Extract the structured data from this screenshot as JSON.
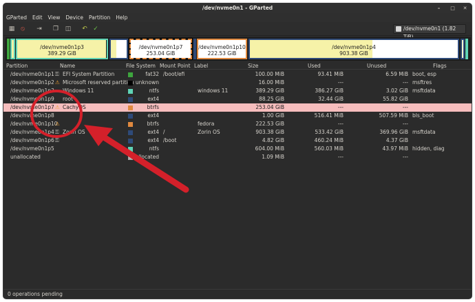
{
  "window": {
    "title": "/dev/nvme0n1 - GParted"
  },
  "menu": [
    "GParted",
    "Edit",
    "View",
    "Device",
    "Partition",
    "Help"
  ],
  "device_selector": "/dev/nvme0n1 (1.82 TiB)",
  "visual": [
    {
      "name": "/dev/nvme0n1p3",
      "size": "389.29 GiB"
    },
    {
      "name": "/dev/nvme0n1p7",
      "size": "253.04 GiB"
    },
    {
      "name": "/dev/nvme0n1p10",
      "size": "222.53 GiB"
    },
    {
      "name": "/dev/nvme0n1p4",
      "size": "903.38 GiB"
    }
  ],
  "columns": [
    "Partition",
    "Name",
    "File System",
    "Mount Point",
    "Label",
    "Size",
    "Used",
    "Unused",
    "Flags"
  ],
  "rows": [
    {
      "partition": "/dev/nvme0n1p1",
      "name": "EFI System Partition",
      "fs": "fat32",
      "mount": "/boot/efi",
      "label": "",
      "size": "100.00 MiB",
      "used": "93.41 MiB",
      "unused": "6.59 MiB",
      "flags": "boot, esp",
      "key": true,
      "warn": false,
      "color": "#3ea53e"
    },
    {
      "partition": "/dev/nvme0n1p2",
      "name": "Microsoft reserved partition",
      "fs": "unknown",
      "mount": "",
      "label": "",
      "size": "16.00 MiB",
      "used": "---",
      "unused": "---",
      "flags": "msftres",
      "key": false,
      "warn": true,
      "color": "#000000"
    },
    {
      "partition": "/dev/nvme0n1p3",
      "name": "Windows 11",
      "fs": "ntfs",
      "mount": "",
      "label": "windows 11",
      "size": "389.29 GiB",
      "used": "386.27 GiB",
      "unused": "3.02 GiB",
      "flags": "msftdata",
      "key": false,
      "warn": false,
      "color": "#5fd3b5"
    },
    {
      "partition": "/dev/nvme0n1p9",
      "name": "root",
      "fs": "ext4",
      "mount": "",
      "label": "",
      "size": "88.25 GiB",
      "used": "32.44 GiB",
      "unused": "55.82 GiB",
      "flags": "",
      "key": false,
      "warn": false,
      "color": "#2e4a79"
    },
    {
      "partition": "/dev/nvme0n1p7",
      "name": "CachyOS",
      "fs": "btrfs",
      "mount": "",
      "label": "",
      "size": "253.04 GiB",
      "used": "---",
      "unused": "---",
      "flags": "",
      "key": false,
      "warn": true,
      "color": "#e0893f",
      "selected": true
    },
    {
      "partition": "/dev/nvme0n1p8",
      "name": "",
      "fs": "ext4",
      "mount": "",
      "label": "",
      "size": "1.00 GiB",
      "used": "516.41 MiB",
      "unused": "507.59 MiB",
      "flags": "bls_boot",
      "key": false,
      "warn": false,
      "color": "#2e4a79"
    },
    {
      "partition": "/dev/nvme0n1p10",
      "name": "",
      "fs": "btrfs",
      "mount": "",
      "label": "fedora",
      "size": "222.53 GiB",
      "used": "---",
      "unused": "---",
      "flags": "",
      "key": false,
      "warn": true,
      "color": "#e0893f"
    },
    {
      "partition": "/dev/nvme0n1p4",
      "name": "Zorin OS",
      "fs": "ext4",
      "mount": "/",
      "label": "Zorin OS",
      "size": "903.38 GiB",
      "used": "533.42 GiB",
      "unused": "369.96 GiB",
      "flags": "msftdata",
      "key": true,
      "warn": false,
      "color": "#2e4a79"
    },
    {
      "partition": "/dev/nvme0n1p6",
      "name": "",
      "fs": "ext4",
      "mount": "/boot",
      "label": "",
      "size": "4.82 GiB",
      "used": "460.24 MiB",
      "unused": "4.37 GiB",
      "flags": "",
      "key": true,
      "warn": false,
      "color": "#2e4a79"
    },
    {
      "partition": "/dev/nvme0n1p5",
      "name": "",
      "fs": "ntfs",
      "mount": "",
      "label": "",
      "size": "604.00 MiB",
      "used": "560.03 MiB",
      "unused": "43.97 MiB",
      "flags": "hidden, diag",
      "key": false,
      "warn": false,
      "color": "#5fd3b5"
    },
    {
      "partition": "unallocated",
      "name": "",
      "fs": "unallocated",
      "mount": "",
      "label": "",
      "size": "1.09 MiB",
      "used": "---",
      "unused": "---",
      "flags": "",
      "key": false,
      "warn": false,
      "color": "#a8a8a8"
    }
  ],
  "status": "0 operations pending",
  "colors": {
    "selected_row": "#f6bdbd",
    "annotation": "#d4202a",
    "partition_border": "#3aa3e3"
  }
}
